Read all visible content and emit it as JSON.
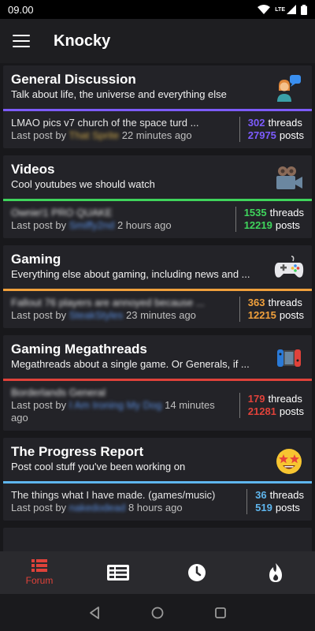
{
  "status_bar": {
    "time": "09.00",
    "network": "LTE"
  },
  "app_bar": {
    "title": "Knocky"
  },
  "subforums": [
    {
      "title": "General Discussion",
      "description": "Talk about life, the universe and everything else",
      "accent": "#7d5cff",
      "icon": "person-chat-icon",
      "last_thread": "LMAO pics v7 church of the space turd ...",
      "last_post_prefix": "Last post by",
      "last_user": "That Sprite",
      "last_time": "22 minutes ago",
      "threads": "302",
      "posts": "27975",
      "threads_label": "threads",
      "posts_label": "posts"
    },
    {
      "title": "Videos",
      "description": "Cool youtubes we should watch",
      "accent": "#3fd45c",
      "icon": "video-camera-icon",
      "last_thread": "Ownie!1 PRO QUAKE",
      "last_post_prefix": "Last post by",
      "last_user": "Smiffy2nd",
      "last_time": "2 hours ago",
      "threads": "1535",
      "posts": "12219",
      "threads_label": "threads",
      "posts_label": "posts"
    },
    {
      "title": "Gaming",
      "description": "Everything else about gaming, including news and ...",
      "accent": "#f0a03c",
      "icon": "gamepad-icon",
      "last_thread": "Fallout 76 players are annoyed because ...",
      "last_post_prefix": "Last post by",
      "last_user": "SteakStyles",
      "last_time": "23 minutes ago",
      "threads": "363",
      "posts": "12215",
      "threads_label": "threads",
      "posts_label": "posts"
    },
    {
      "title": "Gaming Megathreads",
      "description": "Megathreads about a single game. Or Generals, if ...",
      "accent": "#e0423a",
      "icon": "game-console-icon",
      "last_thread": "Borderlands General",
      "last_post_prefix": "Last post by",
      "last_user": "I Am Ironing My Dog",
      "last_time": "14 minutes ago",
      "threads": "179",
      "posts": "21281",
      "threads_label": "threads",
      "posts_label": "posts"
    },
    {
      "title": "The Progress Report",
      "description": "Post cool stuff you've been working on",
      "accent": "#5fb6ee",
      "icon": "star-struck-icon",
      "last_thread": "The things what I have made. (games/music)",
      "last_post_prefix": "Last post by",
      "last_user": "nakedodead",
      "last_time": "8 hours ago",
      "threads": "36",
      "posts": "519",
      "threads_label": "threads",
      "posts_label": "posts"
    }
  ],
  "bottom_nav": {
    "forum_label": "Forum",
    "items": [
      "forum-icon",
      "threads-icon",
      "clock-icon",
      "fire-icon"
    ]
  }
}
